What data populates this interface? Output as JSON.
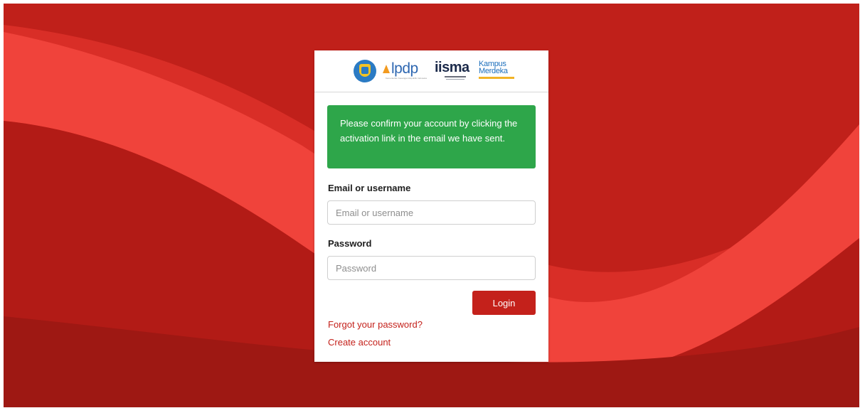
{
  "logos": {
    "lpdp": "lpdp",
    "lpdp_tagline": "Kementerian Keuangan Republik Indonesia",
    "iisma": "iisma",
    "kampus_line1": "Kampus",
    "kampus_line2": "Merdeka"
  },
  "alert": {
    "message": "Please confirm your account by clicking the activation link in the email we have sent."
  },
  "form": {
    "email_label": "Email or username",
    "email_placeholder": "Email or username",
    "email_value": "",
    "password_label": "Password",
    "password_placeholder": "Password",
    "password_value": "",
    "login_label": "Login",
    "forgot_link": "Forgot your password?",
    "create_link": "Create account"
  },
  "colors": {
    "background": "#c0201a",
    "wave_light": "#f0433b",
    "alert_bg": "#2ea64a",
    "accent": "#c4211b"
  }
}
